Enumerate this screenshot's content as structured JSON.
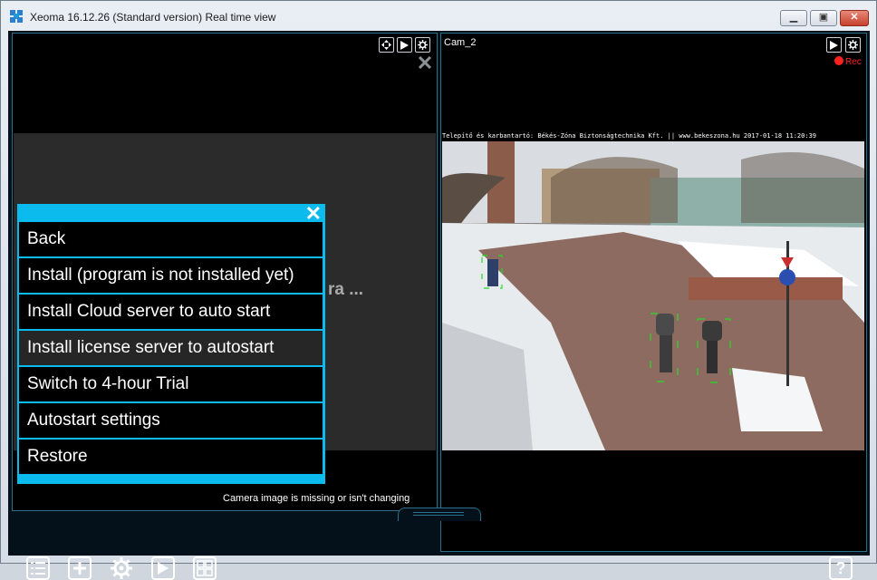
{
  "window": {
    "title": "Xeoma 16.12.26 (Standard version) Real time view",
    "minimize_label": "▁",
    "maximize_label": "▣",
    "close_label": "✕"
  },
  "left_panel": {
    "partial_text": "ra ...",
    "status_text": "Camera image is missing or isn't changing"
  },
  "right_panel": {
    "camera_name": "Cam_2",
    "rec_label": "Rec",
    "overlay_text": "Telepítő és karbantartó: Békés-Zóna Biztonságtechnika Kft. || www.bekeszona.hu 2017-01-18 11:20:39"
  },
  "menu": {
    "close_label": "✕",
    "items": [
      {
        "label": "Back"
      },
      {
        "label": "Install (program is not installed yet)"
      },
      {
        "label": "Install Cloud server to auto start"
      },
      {
        "label": "Install license server to autostart"
      },
      {
        "label": "Switch to 4-hour Trial"
      },
      {
        "label": "Autostart settings"
      },
      {
        "label": "Restore"
      }
    ]
  },
  "toolbar": {
    "help_label": "?"
  },
  "colors": {
    "accent": "#0bbbee",
    "rec": "#ff2020"
  }
}
